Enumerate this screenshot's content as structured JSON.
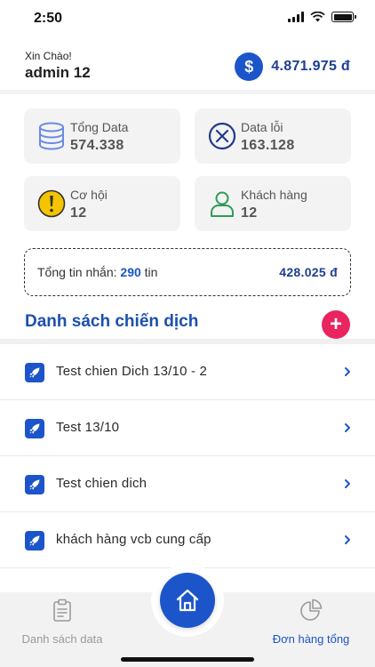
{
  "status_bar": {
    "time": "2:50"
  },
  "header": {
    "greeting": "Xin Chào!",
    "username": "admin 12",
    "balance": "4.871.975 đ",
    "balance_icon": "$"
  },
  "stats": [
    {
      "label": "Tổng Data",
      "value": "574.338",
      "icon": "database-icon",
      "color": "#6a8be0"
    },
    {
      "label": "Data lỗi",
      "value": "163.128",
      "icon": "error-x-icon",
      "color": "#233a8a"
    },
    {
      "label": "Cơ hội",
      "value": "12",
      "icon": "opportunity-icon",
      "color": "#f5c400"
    },
    {
      "label": "Khách hàng",
      "value": "12",
      "icon": "customer-icon",
      "color": "#2c9c55"
    }
  ],
  "messages": {
    "prefix": "Tổng tin nhắn: ",
    "count": "290",
    "suffix": " tin",
    "amount": "428.025 đ"
  },
  "campaigns": {
    "title": "Danh sách chiến dịch",
    "add_label": "+",
    "items": [
      {
        "label": "Test chien Dich 13/10 - 2"
      },
      {
        "label": "Test 13/10"
      },
      {
        "label": "Test chien dich"
      },
      {
        "label": "khách hàng vcb cung cấp"
      }
    ]
  },
  "bottom_nav": {
    "left_label": "Danh sách data",
    "right_label": "Đơn hàng tổng",
    "active": "right"
  },
  "colors": {
    "primary": "#1c55c9",
    "accent": "#e9245e",
    "card_bg": "#f3f3f3"
  }
}
